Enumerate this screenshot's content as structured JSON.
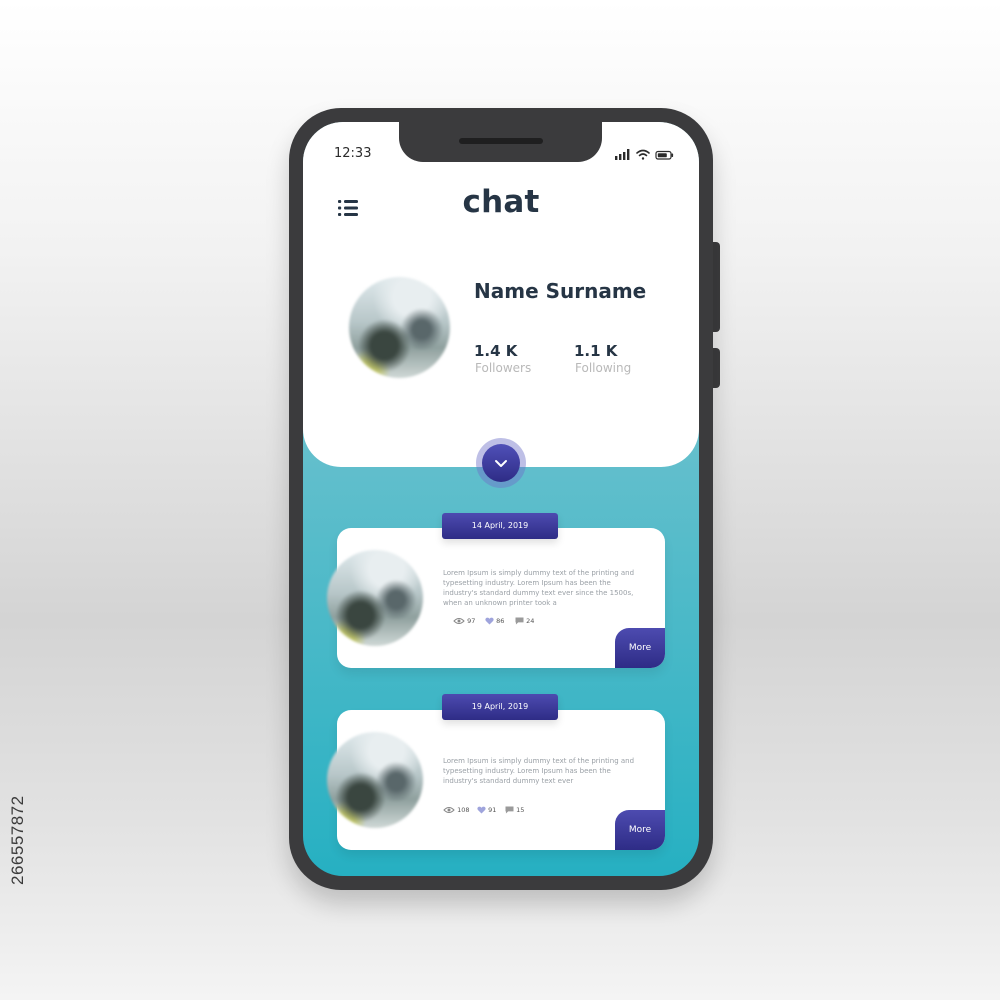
{
  "status_bar": {
    "time": "12:33"
  },
  "header": {
    "title": "chat",
    "menu_icon": "list-menu-icon"
  },
  "profile": {
    "name": "Name Surname",
    "followers_value": "1.4 K",
    "followers_label": "Followers",
    "following_value": "1.1 K",
    "following_label": "Following"
  },
  "expand_icon": "chevron-down-icon",
  "posts": [
    {
      "date": "14 April, 2019",
      "text": "Lorem Ipsum is simply dummy text of the printing and typesetting industry. Lorem Ipsum has been the industry's standard dummy text ever since the 1500s, when an unknown printer took a",
      "views": "97",
      "likes": "86",
      "comments": "24",
      "more_label": "More"
    },
    {
      "date": "19 April, 2019",
      "text": "Lorem Ipsum is simply dummy text of the printing and typesetting industry. Lorem Ipsum has been the industry's standard dummy text ever",
      "views": "108",
      "likes": "91",
      "comments": "15",
      "more_label": "More"
    }
  ],
  "watermark": "266557872",
  "colors": {
    "accent": "#2e2c86",
    "title_text": "#263545",
    "teal_top": "#8ed0d8",
    "teal_bottom": "#26b0c2",
    "phone_body": "#3b3b3d"
  }
}
